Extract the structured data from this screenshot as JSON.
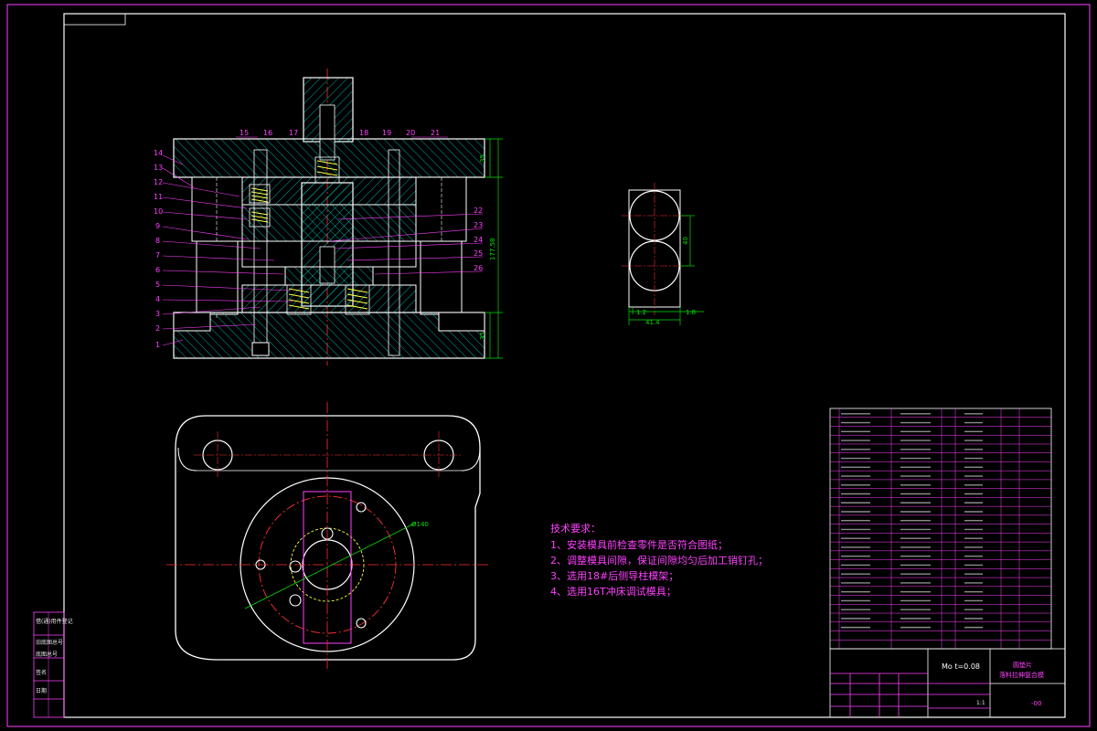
{
  "drawing": {
    "tech_requirements": {
      "heading": "技术要求：",
      "items": [
        "1、安装模具前检查零件是否符合图纸；",
        "2、调整模具间隙，保证间隙均匀后加工销钉孔；",
        "3、选用18#后侧导柱模架；",
        "4、选用16T冲床调试模具；"
      ]
    },
    "part_bubbles_left": [
      "14",
      "13",
      "12",
      "11",
      "10",
      "9",
      "8",
      "7",
      "6",
      "5",
      "4",
      "3",
      "2",
      "1"
    ],
    "part_bubbles_top": [
      "15",
      "16",
      "17",
      "18",
      "19",
      "20",
      "21"
    ],
    "part_bubbles_right": [
      "22",
      "23",
      "24",
      "25",
      "26"
    ],
    "dimensions": {
      "top_plate": "35",
      "total_height": "177.58",
      "bottom_plate": "35",
      "strip_width": "40",
      "strip_left": "1.2",
      "strip_right": "1.8",
      "strip_total": "41.4",
      "circle_dia": "Ø140"
    },
    "title_block": {
      "material_line": "Mo  t=0.08",
      "part_title_1": "圆垫片",
      "part_title_2": "落料拉伸复合模",
      "drawing_no": "-00",
      "scale": "1:1"
    },
    "left_strip_labels": [
      "借(通)用件登记",
      "旧底图总号",
      "底图总号",
      "签名",
      "日期"
    ],
    "colors": {
      "border": "#ff40ff",
      "section": "#00d0d0",
      "center": "#ff3030",
      "dim": "#00e000",
      "outline": "#ffffff"
    }
  }
}
